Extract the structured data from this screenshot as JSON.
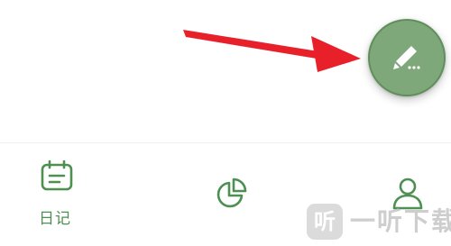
{
  "colors": {
    "accent_green": "#4e8f52",
    "fab_fill": "#7ea87a",
    "fab_border": "#5f8f5b",
    "arrow_red": "#e8202a",
    "watermark_gray": "#bfbfbf"
  },
  "fab": {
    "icon": "pencil-icon"
  },
  "tabs": [
    {
      "label": "日记",
      "icon": "calendar-icon",
      "active": true
    },
    {
      "label": "",
      "icon": "pie-chart-icon",
      "active": false
    },
    {
      "label": "",
      "icon": "person-icon",
      "active": false
    }
  ],
  "watermark": {
    "badge": "听",
    "text": "一听下载"
  }
}
